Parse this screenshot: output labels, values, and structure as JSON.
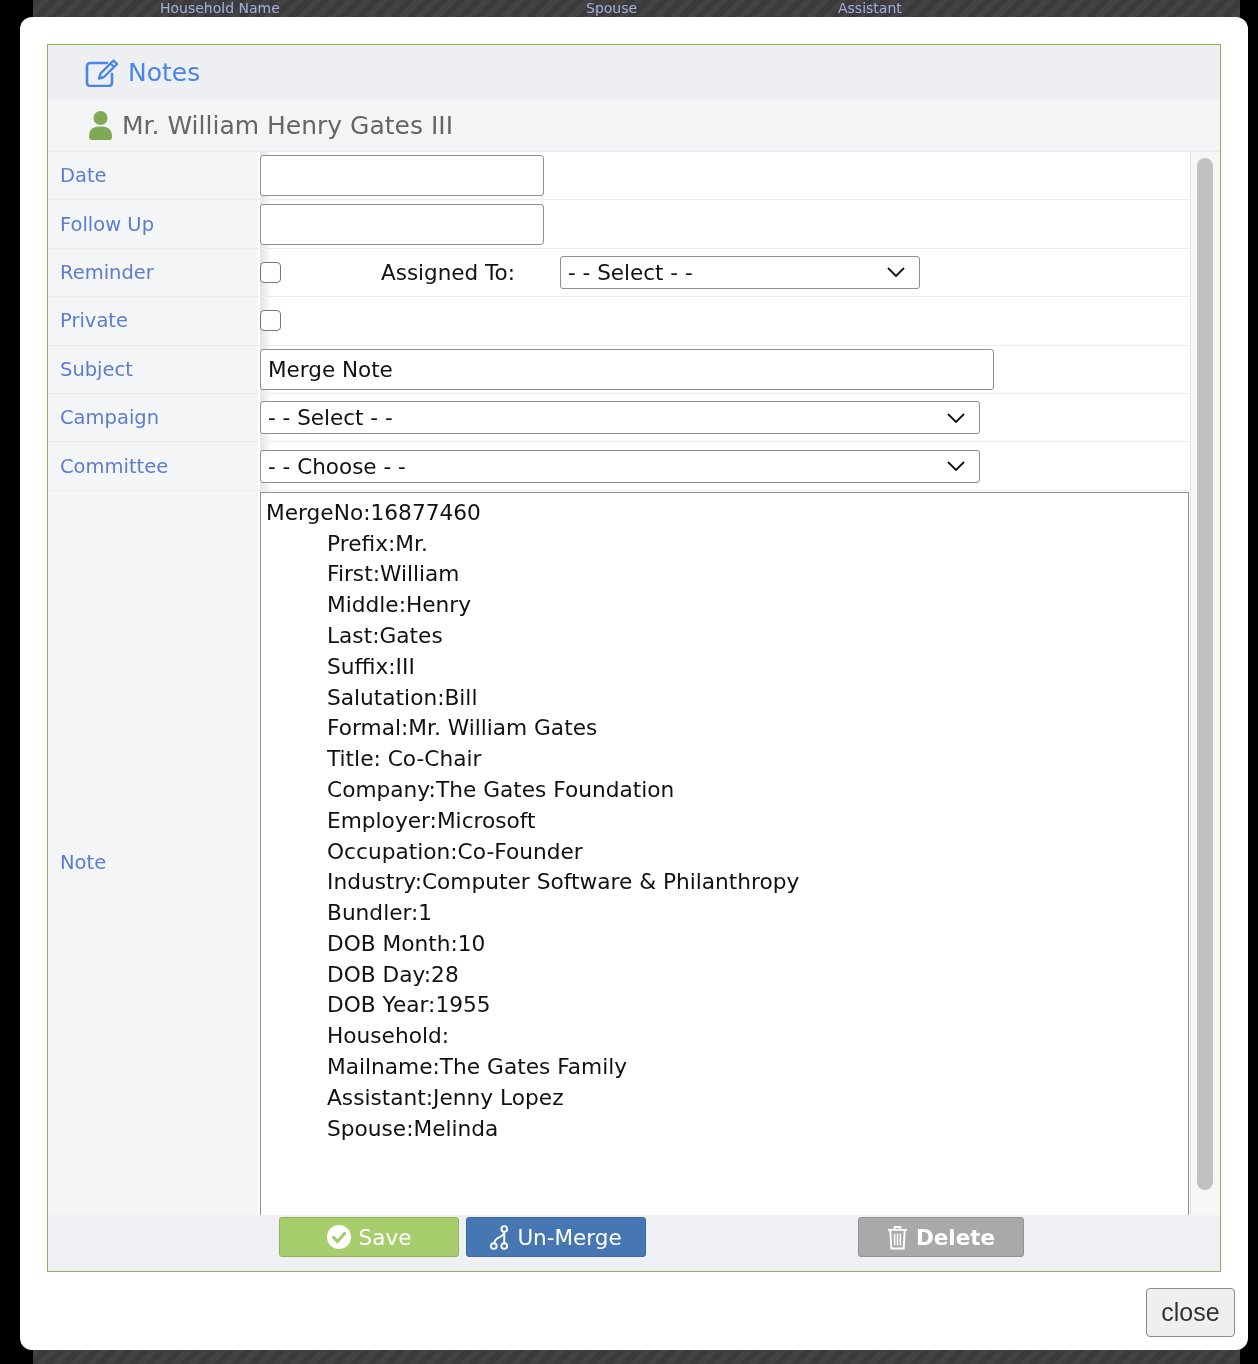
{
  "backdrop": {
    "columns": [
      "Household Name",
      "Spouse",
      "Assistant"
    ]
  },
  "dialog": {
    "title": "Notes",
    "contact": "Mr. William Henry Gates III",
    "fields": [
      {
        "kind": "date",
        "label": "Date"
      },
      {
        "kind": "date",
        "label": "Follow Up"
      },
      {
        "kind": "checkbox",
        "label": "Reminder",
        "checked": false,
        "assigned_to": {
          "label": "Assigned To:",
          "value": "- - Select - -"
        }
      },
      {
        "kind": "checkbox",
        "label": "Private",
        "checked": false
      },
      {
        "kind": "text",
        "label": "Subject",
        "value": "Merge Note"
      },
      {
        "kind": "select",
        "label": "Campaign",
        "value": "- - Select - -"
      },
      {
        "kind": "select",
        "label": "Committee",
        "value": "- - Choose - -"
      },
      {
        "kind": "textarea",
        "label": "Note",
        "value": "MergeNo:16877460\n\tPrefix:Mr.\n\tFirst:William\n\tMiddle:Henry\n\tLast:Gates\n\tSuffix:III\n\tSalutation:Bill\n\tFormal:Mr. William Gates\n\tTitle: Co-Chair\n\tCompany:The Gates Foundation\n\tEmployer:Microsoft\n\tOccupation:Co-Founder\n\tIndustry:Computer Software & Philanthropy\n\tBundler:1\n\tDOB Month:10\n\tDOB Day:28\n\tDOB Year:1955\n\tHousehold:\n\tMailname:The Gates Family\n\tAssistant:Jenny Lopez\n\tSpouse:Melinda"
      }
    ],
    "buttons": [
      {
        "kind": "save",
        "label": "Save"
      },
      {
        "kind": "unmerge",
        "label": "Un-Merge"
      },
      {
        "kind": "delete",
        "label": "Delete"
      }
    ]
  },
  "close_button": {
    "label": "close"
  }
}
